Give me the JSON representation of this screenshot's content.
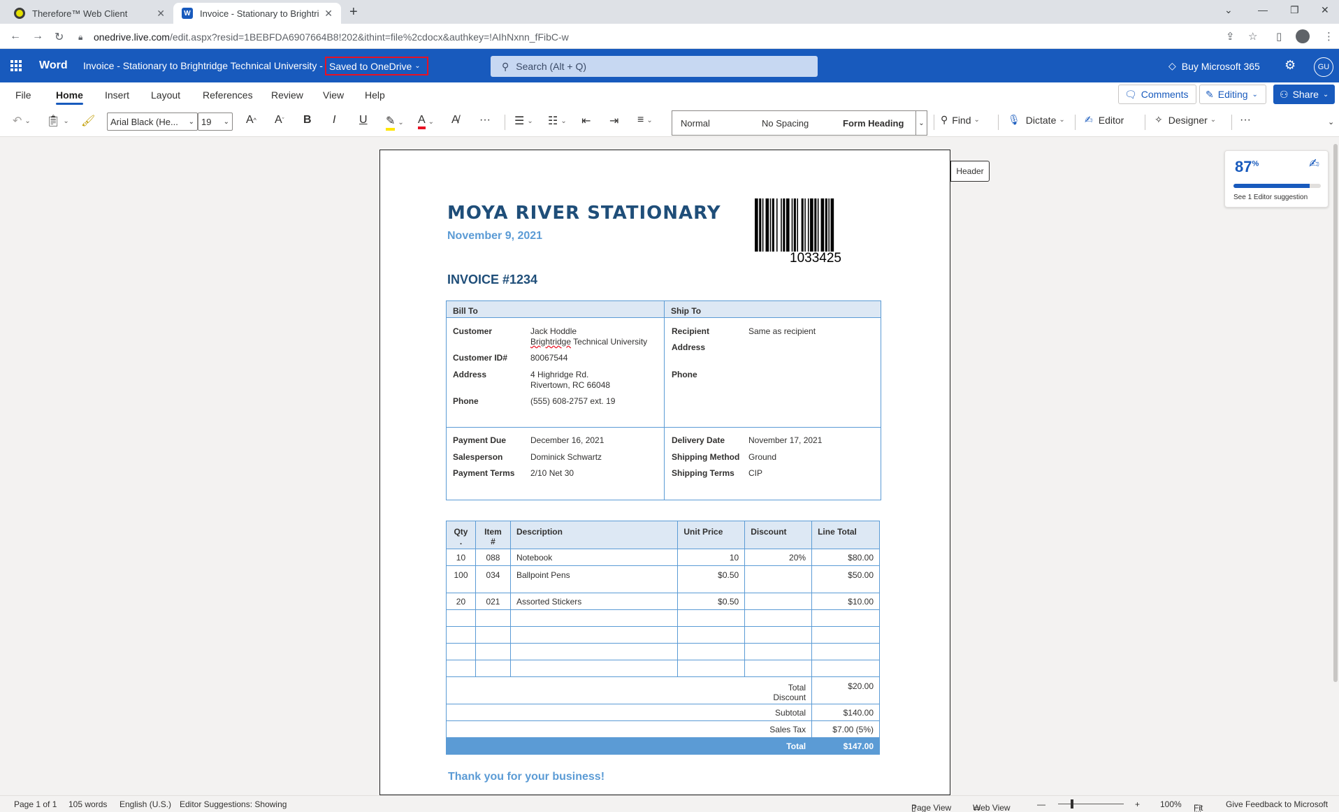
{
  "browser": {
    "tabs": [
      {
        "label": "Therefore™ Web Client"
      },
      {
        "label": "Invoice - Stationary to Brightridge"
      }
    ],
    "url_host": "onedrive.live.com",
    "url_path": "/edit.aspx?resid=1BEBFDA6907664B8!202&ithint=file%2cdocx&authkey=!AIhNxnn_fFibC-w"
  },
  "app": {
    "name": "Word",
    "doc_title": "Invoice - Stationary to Brightridge Technical University",
    "title_sep": "-",
    "save_status": "Saved to OneDrive",
    "search_placeholder": "Search (Alt + Q)",
    "buy": "Buy Microsoft 365",
    "account_initials": "GU"
  },
  "ribbon": {
    "tabs": [
      "File",
      "Home",
      "Insert",
      "Layout",
      "References",
      "Review",
      "View",
      "Help"
    ],
    "active_tab": "Home",
    "comments": "Comments",
    "editing": "Editing",
    "share": "Share",
    "font_name": "Arial Black (He...",
    "font_size": "19",
    "styles": [
      "Normal",
      "No Spacing",
      "Form Heading"
    ],
    "find": "Find",
    "dictate": "Dictate",
    "editor": "Editor",
    "designer": "Designer"
  },
  "side": {
    "header_tag": "Header",
    "editor_score": "87",
    "editor_score_unit": "%",
    "editor_progress": 0.87,
    "editor_suggestion": "See 1 Editor suggestion"
  },
  "invoice": {
    "company": "MOYA RIVER STATIONARY",
    "date": "November 9, 2021",
    "barcode_number": "1033425",
    "invoice_no": "INVOICE #1234",
    "bill_to": {
      "heading": "Bill To",
      "customer_label": "Customer",
      "customer_name": "Jack Hoddle",
      "customer_org_a": "Brightridge",
      "customer_org_b": " Technical University",
      "customer_id_label": "Customer ID#",
      "customer_id": "80067544",
      "address_label": "Address",
      "address_1": "4 Highridge Rd.",
      "address_2": "Rivertown, RC 66048",
      "phone_label": "Phone",
      "phone": "(555) 608-2757 ext. 19"
    },
    "ship_to": {
      "heading": "Ship To",
      "recipient_label": "Recipient",
      "recipient": "Same as recipient",
      "address_label": "Address",
      "phone_label": "Phone"
    },
    "terms": {
      "payment_due_label": "Payment Due",
      "payment_due": "December 16, 2021",
      "salesperson_label": "Salesperson",
      "salesperson": "Dominick Schwartz",
      "payment_terms_label": "Payment Terms",
      "payment_terms": "2/10 Net 30",
      "delivery_date_label": "Delivery Date",
      "delivery_date": "November 17, 2021",
      "shipping_method_label": "Shipping Method",
      "shipping_method": "Ground",
      "shipping_terms_label": "Shipping Terms",
      "shipping_terms": "CIP"
    },
    "columns": [
      "Qty .",
      "Item #",
      "Description",
      "Unit Price",
      "Discount",
      "Line Total"
    ],
    "rows": [
      {
        "qty": "10",
        "item": "088",
        "desc": "Notebook",
        "price": "10",
        "discount": "20%",
        "total": "$80.00"
      },
      {
        "qty": "100",
        "item": "034",
        "desc": "Ballpoint Pens",
        "price": "$0.50",
        "discount": "",
        "total": "$50.00"
      },
      {
        "qty": "20",
        "item": "021",
        "desc": "Assorted Stickers",
        "price": "$0.50",
        "discount": "",
        "total": "$10.00"
      }
    ],
    "summary": {
      "total_discount_label_1": "Total",
      "total_discount_label_2": "Discount",
      "total_discount": "$20.00",
      "subtotal_label": "Subtotal",
      "subtotal": "$140.00",
      "sales_tax_label": "Sales Tax",
      "sales_tax": "$7.00 (5%)",
      "total_label": "Total",
      "total": "$147.00"
    },
    "thanks": "Thank you for your business!"
  },
  "status": {
    "page": "Page 1 of 1",
    "words": "105 words",
    "language": "English (U.S.)",
    "editor_suggestions": "Editor Suggestions: Showing",
    "page_view": "Page View",
    "web_view": "Web View",
    "zoom": "100%",
    "fit": "Fit",
    "feedback": "Give Feedback to Microsoft"
  }
}
